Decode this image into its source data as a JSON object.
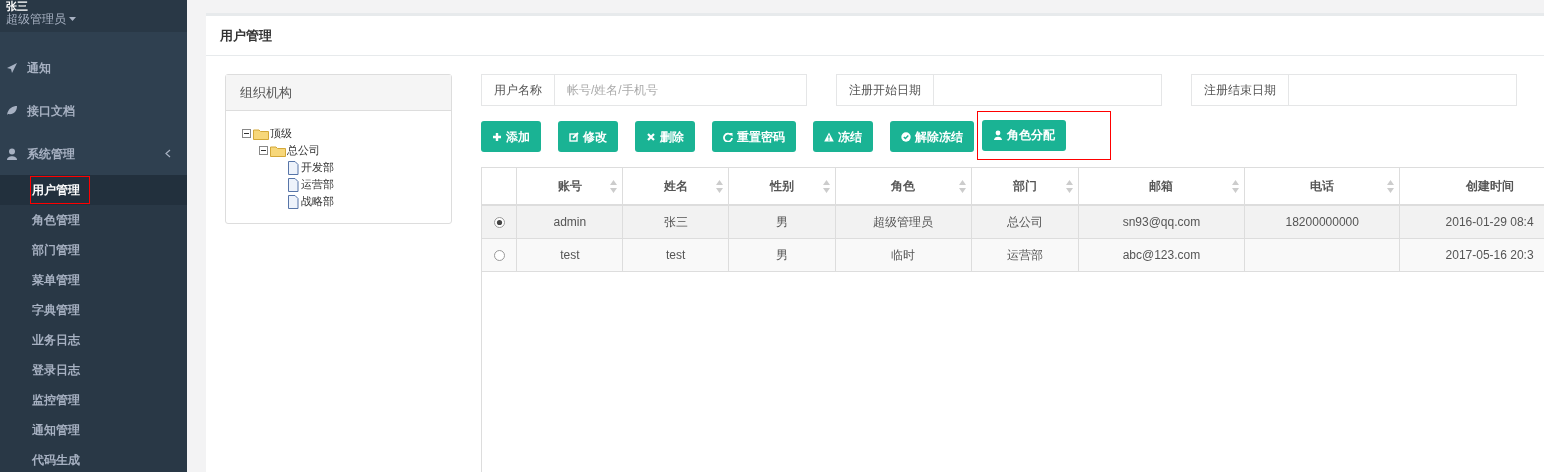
{
  "sidebar": {
    "user_name": "张三",
    "user_role": "超级管理员",
    "menu": [
      {
        "label": "通知"
      },
      {
        "label": "接口文档"
      },
      {
        "label": "系统管理",
        "expanded": true,
        "children": [
          {
            "label": "用户管理",
            "selected": true,
            "highlighted": true
          },
          {
            "label": "角色管理",
            "selected": false,
            "highlighted": false
          },
          {
            "label": "部门管理",
            "selected": false,
            "highlighted": false
          },
          {
            "label": "菜单管理",
            "selected": false,
            "highlighted": false
          },
          {
            "label": "字典管理",
            "selected": false,
            "highlighted": false
          },
          {
            "label": "业务日志",
            "selected": false,
            "highlighted": false
          },
          {
            "label": "登录日志",
            "selected": false,
            "highlighted": false
          },
          {
            "label": "监控管理",
            "selected": false,
            "highlighted": false
          },
          {
            "label": "通知管理",
            "selected": false,
            "highlighted": false
          },
          {
            "label": "代码生成",
            "selected": false,
            "highlighted": false
          }
        ]
      }
    ]
  },
  "page_title": "用户管理",
  "org_panel": {
    "title": "组织机构",
    "tree": [
      {
        "label": "顶级",
        "kind": "folder",
        "expanded": true,
        "children": [
          {
            "label": "总公司",
            "kind": "folder",
            "expanded": true,
            "children": [
              {
                "label": "开发部",
                "kind": "file"
              },
              {
                "label": "运营部",
                "kind": "file"
              },
              {
                "label": "战略部",
                "kind": "file"
              }
            ]
          }
        ]
      }
    ]
  },
  "filters": [
    {
      "label": "用户名称",
      "placeholder": "帐号/姓名/手机号"
    },
    {
      "label": "注册开始日期"
    },
    {
      "label": "注册结束日期"
    }
  ],
  "buttons": [
    {
      "label": "添加",
      "highlighted": false
    },
    {
      "label": "修改",
      "highlighted": false
    },
    {
      "label": "删除",
      "highlighted": false
    },
    {
      "label": "重置密码",
      "highlighted": false
    },
    {
      "label": "冻结",
      "highlighted": false
    },
    {
      "label": "解除冻结",
      "highlighted": false
    },
    {
      "label": "角色分配",
      "highlighted": true
    }
  ],
  "table": {
    "columns": [
      "账号",
      "姓名",
      "性别",
      "角色",
      "部门",
      "邮箱",
      "电话",
      "创建时间"
    ],
    "rows": [
      {
        "selected": true,
        "cells": [
          "admin",
          "张三",
          "男",
          "超级管理员",
          "总公司",
          "sn93@qq.com",
          "18200000000",
          "2016-01-29 08:4"
        ]
      },
      {
        "selected": false,
        "cells": [
          "test",
          "test",
          "男",
          "临时",
          "运营部",
          "abc@123.com",
          "",
          "2017-05-16 20:3"
        ]
      }
    ]
  }
}
